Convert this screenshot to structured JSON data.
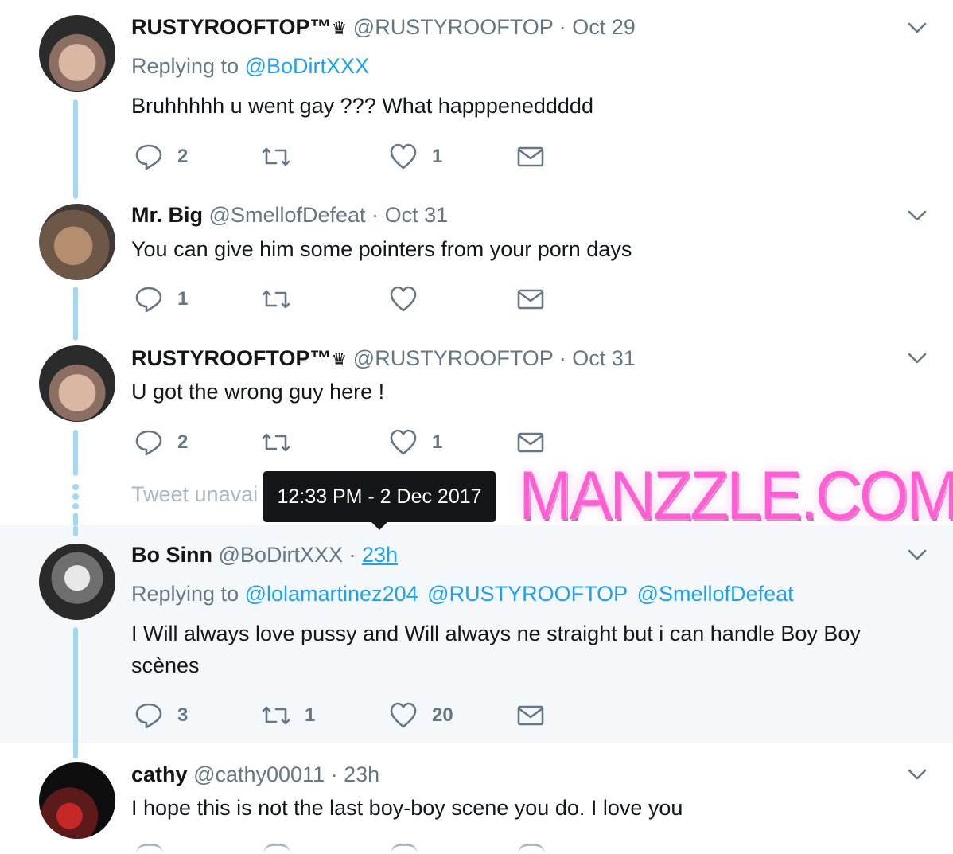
{
  "tweets": [
    {
      "name": "RUSTYROOFTOP™",
      "crown": "♛",
      "handle": "@RUSTYROOFTOP",
      "time": "Oct 29",
      "replying_label": "Replying to",
      "replying_to": [
        "@BoDirtXXX"
      ],
      "text": "Bruhhhhh u went gay ??? What happpeneddddd",
      "replies": "2",
      "retweets": "",
      "likes": "1"
    },
    {
      "name": "Mr. Big",
      "handle": "@SmellofDefeat",
      "time": "Oct 31",
      "text": "You can give him some pointers from your porn days",
      "replies": "1",
      "retweets": "",
      "likes": ""
    },
    {
      "name": "RUSTYROOFTOP™",
      "crown": "♛",
      "handle": "@RUSTYROOFTOP",
      "time": "Oct 31",
      "text": "U got the wrong guy here !",
      "replies": "2",
      "retweets": "",
      "likes": "1"
    },
    {
      "name": "Bo Sinn",
      "handle": "@BoDirtXXX",
      "time": "23h",
      "replying_label": "Replying to",
      "replying_to": [
        "@lolamartinez204",
        "@RUSTYROOFTOP",
        "@SmellofDefeat"
      ],
      "text_line1": "I Will always love pussy and Will always ne straight but i can handle Boy Boy",
      "text_line2": "scènes",
      "replies": "3",
      "retweets": "1",
      "likes": "20"
    },
    {
      "name": "cathy",
      "handle": "@cathy00011",
      "time": "23h",
      "text": "I hope this is not the last boy-boy scene you do.  I love you"
    }
  ],
  "separator": "·",
  "unavailable_text": "Tweet unavai",
  "tooltip": "12:33 PM - 2 Dec 2017",
  "watermark": "MANZZLE.COM",
  "colors": {
    "link": "#1da1f2",
    "muted": "#657786",
    "thread": "#a3d8f4",
    "highlight_bg": "#f5f8fa",
    "watermark": "#ff5fd2"
  }
}
